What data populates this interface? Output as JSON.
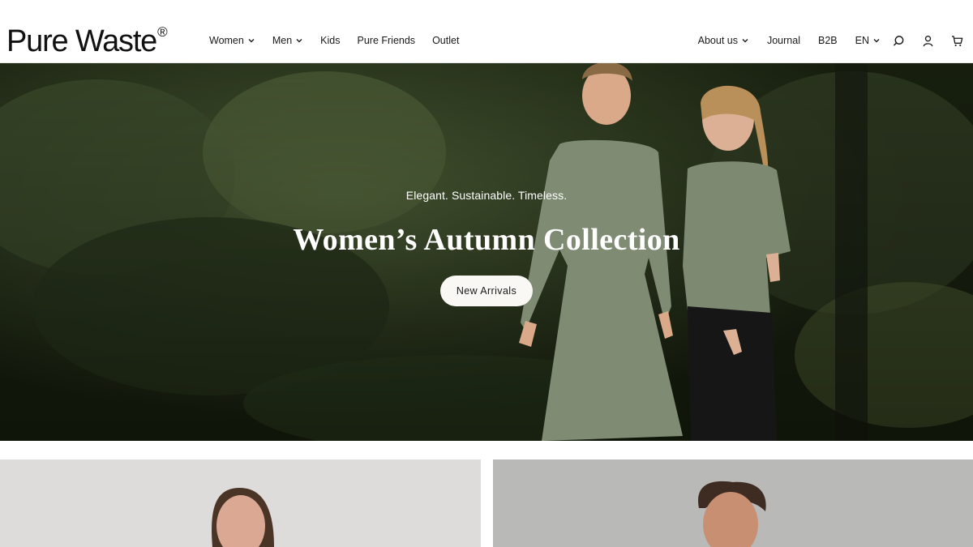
{
  "brand": {
    "name": "Pure Waste",
    "mark": "®"
  },
  "nav": {
    "left": [
      {
        "label": "Women",
        "has_dropdown": true
      },
      {
        "label": "Men",
        "has_dropdown": true
      },
      {
        "label": "Kids",
        "has_dropdown": false
      },
      {
        "label": "Pure Friends",
        "has_dropdown": false
      },
      {
        "label": "Outlet",
        "has_dropdown": false
      }
    ],
    "right": [
      {
        "label": "About us",
        "has_dropdown": true
      },
      {
        "label": "Journal",
        "has_dropdown": false
      },
      {
        "label": "B2B",
        "has_dropdown": false
      },
      {
        "label": "EN",
        "has_dropdown": true
      }
    ],
    "icons": [
      "search-icon",
      "account-icon",
      "cart-icon"
    ]
  },
  "hero": {
    "tagline": "Elegant. Sustainable. Timeless.",
    "title": "Women’s Autumn Collection",
    "cta_label": "New Arrivals"
  },
  "colors": {
    "text": "#1a1a1a",
    "hero_overlay_text": "#ffffff",
    "cta_bg": "#faf8f4",
    "garment_green": "#7d8970",
    "forest_dark": "#1c2516"
  }
}
